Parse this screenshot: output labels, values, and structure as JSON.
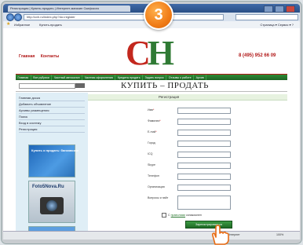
{
  "step_number": "3",
  "browser": {
    "tab_label": "Регистрация | Купить-продать | Интернет-магазин Скифского",
    "url": "http://cvh.ru/index.php?do=register",
    "favorites_label": "Избранное",
    "bookmark_label": "Купить-продать",
    "tools_label": "Страница ▾  Сервис ▾  ?"
  },
  "header": {
    "links": [
      "Главная",
      "Контакты"
    ],
    "logo_c": "С",
    "logo_h": "Н",
    "phone": "8 (495) 952 66 09"
  },
  "menu": {
    "items": [
      "Главная",
      "Все рубрики",
      "Частный автосалон",
      "Частная оформления",
      "Кредиты продать",
      "Задать вопрос",
      "Отзывы о работе",
      "Архив"
    ]
  },
  "page_title": "КУПИТЬ – ПРОДАТЬ",
  "sidebar": {
    "links": [
      "Главная доска",
      "Добавить объявление",
      "Архивы размещения",
      "Поиск",
      "Вход в систему",
      "Регистрация"
    ],
    "banner1_text": "Купить и продать: банковское",
    "banner2_text": "Foto5Nova.Ru"
  },
  "form": {
    "heading": "Регистрация",
    "fields": [
      {
        "label": "Имя",
        "required": true
      },
      {
        "label": "Фамилия",
        "required": true
      },
      {
        "label": "E-mail",
        "required": true
      },
      {
        "label": "Город",
        "required": false
      },
      {
        "label": "ICQ",
        "required": false
      },
      {
        "label": "Skype",
        "required": false
      },
      {
        "label": "Телефон",
        "required": false
      },
      {
        "label": "Организация",
        "required": false
      },
      {
        "label": "Вопросы и пайт",
        "required": false
      }
    ],
    "agree_prefix": "С",
    "agree_link": "правилами",
    "agree_suffix": "ознакомлен",
    "submit_label": "Зарегистрироваться"
  },
  "status": {
    "left": "",
    "zone": "Интернет",
    "zoom": "100%"
  },
  "colors": {
    "accent_red": "#c3281e",
    "accent_green": "#2f7a34",
    "step_orange": "#f07c17"
  }
}
